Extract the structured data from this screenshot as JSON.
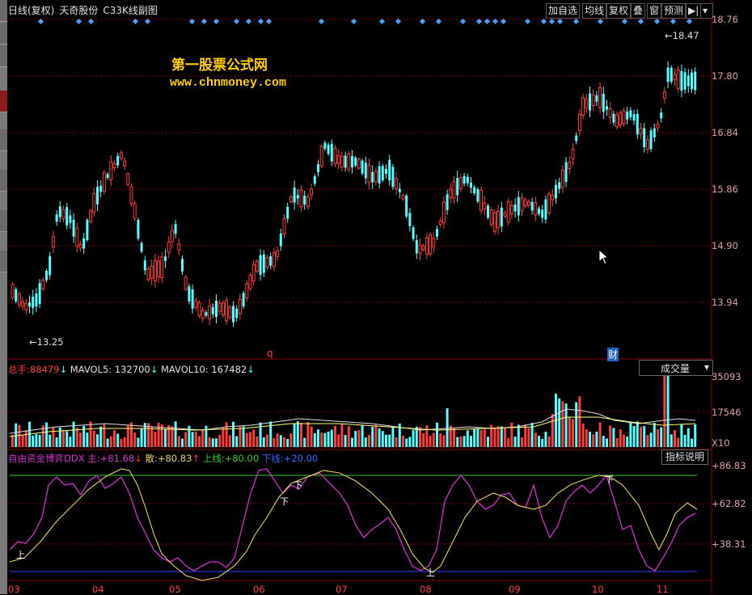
{
  "header": {
    "period": "日线(复权)",
    "stock_name": "天奇股份",
    "indicator_name": "C33K线副图",
    "buttons": [
      "加自选",
      "均线",
      "复权",
      "叠",
      "窗",
      "预测"
    ],
    "nav_icon": "step-forward-icon",
    "menu_icon": "dropdown-arrow-icon"
  },
  "watermark": {
    "line1": "第一股票公式网",
    "line2": "www.chnmoney.com"
  },
  "price_axis": [
    "18.76",
    "17.80",
    "16.84",
    "15.86",
    "14.90",
    "13.94"
  ],
  "price_annotations": {
    "high": "18.47",
    "low": "13.25"
  },
  "markers": {
    "q": "q",
    "cai": "财"
  },
  "volume_panel": {
    "label_total": "总手:",
    "total": "88479",
    "mavol5_label": "MAVOL5:",
    "mavol5": "132700",
    "mavol10_label": "MAVOL10:",
    "mavol10": "167482",
    "dropdown": "成交量",
    "axis": [
      "35093",
      "17546",
      "X10"
    ]
  },
  "indicator_panel": {
    "name": "自由资金博弈DDX",
    "main_label": "主:",
    "main": "+81.68",
    "san_label": "散:",
    "san": "+80.83",
    "up_label": "上线:",
    "up": "+80.00",
    "down_label": "下线:",
    "down": "+20.00",
    "explain_button": "指标说明",
    "axis": [
      "+86.83",
      "+62.82",
      "+38.31"
    ],
    "signals": [
      "上",
      "下",
      "下",
      "上",
      "下"
    ]
  },
  "x_axis": [
    "03",
    "04",
    "05",
    "06",
    "07",
    "08",
    "09",
    "10",
    "11"
  ],
  "colors": {
    "up_candle": "#ff3c3c",
    "down_candle": "#54ffff",
    "grid": "#8b0000",
    "main_line": "#cc33cc",
    "san_line": "#e6d060",
    "upper_line": "#33cc33",
    "lower_line": "#3344ff"
  }
}
